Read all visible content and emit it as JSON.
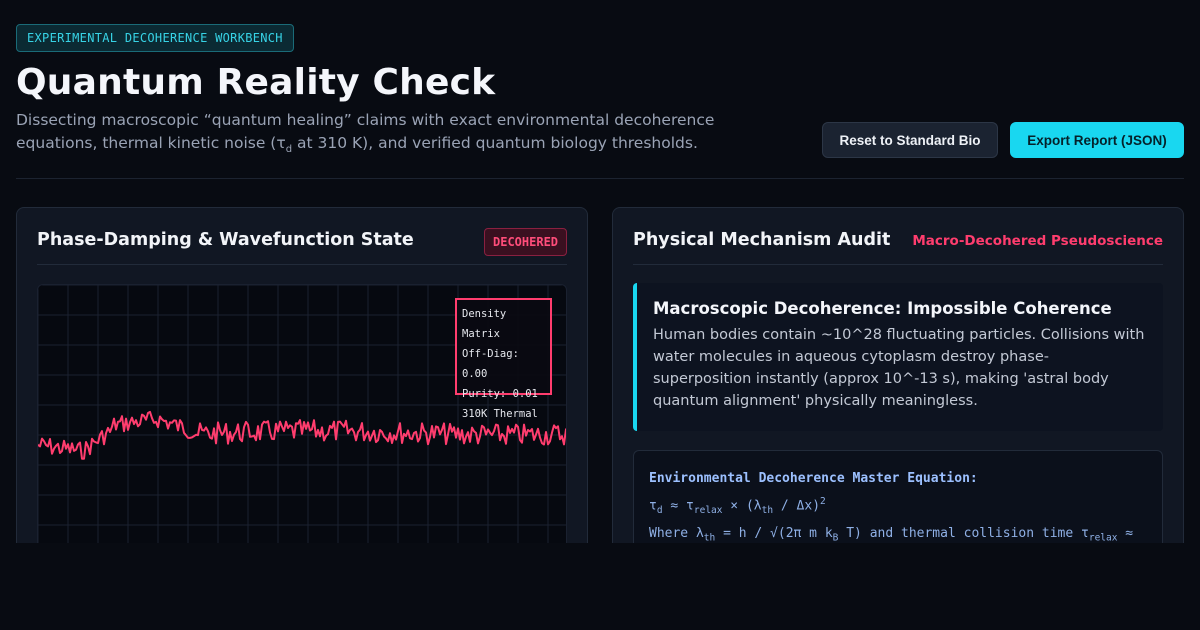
{
  "header": {
    "tag": "EXPERIMENTAL DECOHERENCE WORKBENCH",
    "title": "Quantum Reality Check",
    "subtitle_part1": "Dissecting macroscopic “quantum healing” claims with exact environmental decoherence equations, thermal kinetic noise (τ",
    "subtitle_sub": "d",
    "subtitle_part2": " at 310 K), and verified quantum biology thresholds."
  },
  "actions": {
    "reset_label": "Reset to Standard Bio",
    "export_label": "Export Report (JSON)"
  },
  "left_panel": {
    "title": "Phase-Damping & Wavefunction State",
    "badge": "DECOHERED",
    "matrix": {
      "line1": "Density Matrix",
      "line2": "Off-Diag: 0.00",
      "line3": "Purity: 0.01",
      "line4": "310K Thermal"
    },
    "signal_color": "#ff3d6e"
  },
  "right_panel": {
    "title": "Physical Mechanism Audit",
    "status": "Macro-Decohered Pseudoscience",
    "callout_title": "Macroscopic Decoherence: Impossible Coherence",
    "callout_body": "Human bodies contain ~10^28 fluctuating particles. Collisions with water molecules in aqueous cytoplasm destroy phase-superposition instantly (approx 10^-13 s), making 'astral body quantum alignment' physically meaningless.",
    "equation_heading": "Environmental Decoherence Master Equation:",
    "eq1_a": "τ",
    "eq1_a_sub": "d",
    "eq1_b": " ≈ τ",
    "eq1_b_sub": "relax",
    "eq1_c": " × (λ",
    "eq1_c_sub": "th",
    "eq1_d": " / Δx)",
    "eq1_d_sup": "2",
    "eq2_a": "Where λ",
    "eq2_a_sub": "th",
    "eq2_b": " = h / √(2π m k",
    "eq2_b_sub": "B",
    "eq2_c": " T) and thermal collision time τ",
    "eq2_c_sub": "relax",
    "eq2_d": " ≈"
  },
  "colors": {
    "accent": "#19d7f0",
    "danger": "#ff3d6e",
    "background": "#080b12"
  }
}
